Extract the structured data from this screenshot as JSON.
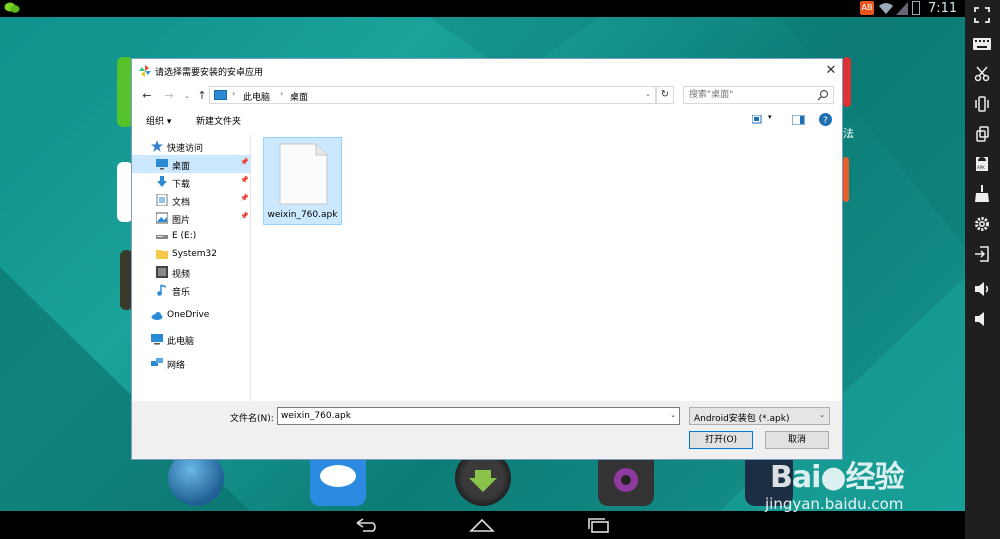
{
  "status_bar": {
    "badge": "AB",
    "time": "7:11"
  },
  "dialog": {
    "title": "请选择需要安装的安卓应用",
    "address": {
      "crumbs": [
        "此电脑",
        "桌面"
      ]
    },
    "search": {
      "placeholder": "搜索\"桌面\""
    },
    "commands": {
      "organize": "组织 ▾",
      "new_folder": "新建文件夹"
    },
    "nav": {
      "quick_access": "快速访问",
      "items": [
        {
          "label": "桌面"
        },
        {
          "label": "下载"
        },
        {
          "label": "文档"
        },
        {
          "label": "图片"
        },
        {
          "label": "E (E:)"
        },
        {
          "label": "System32"
        },
        {
          "label": "视频"
        },
        {
          "label": "音乐"
        }
      ],
      "onedrive": "OneDrive",
      "this_pc": "此电脑",
      "network": "网络"
    },
    "files": [
      {
        "name": "weixin_760.apk"
      }
    ],
    "filename_label": "文件名(N):",
    "filename_value": "weixin_760.apk",
    "filter_value": "Android安装包 (*.apk)",
    "open_button": "打开(O)",
    "cancel_button": "取消"
  },
  "colors": {
    "desktop_teal": "#1aa39a",
    "selection": "#cce8ff",
    "accent": "#0078d7"
  },
  "icons": [
    "back-icon",
    "forward-icon",
    "up-icon",
    "refresh-icon",
    "search-icon",
    "pin-icon",
    "help-icon",
    "view-icon",
    "close-icon"
  ]
}
